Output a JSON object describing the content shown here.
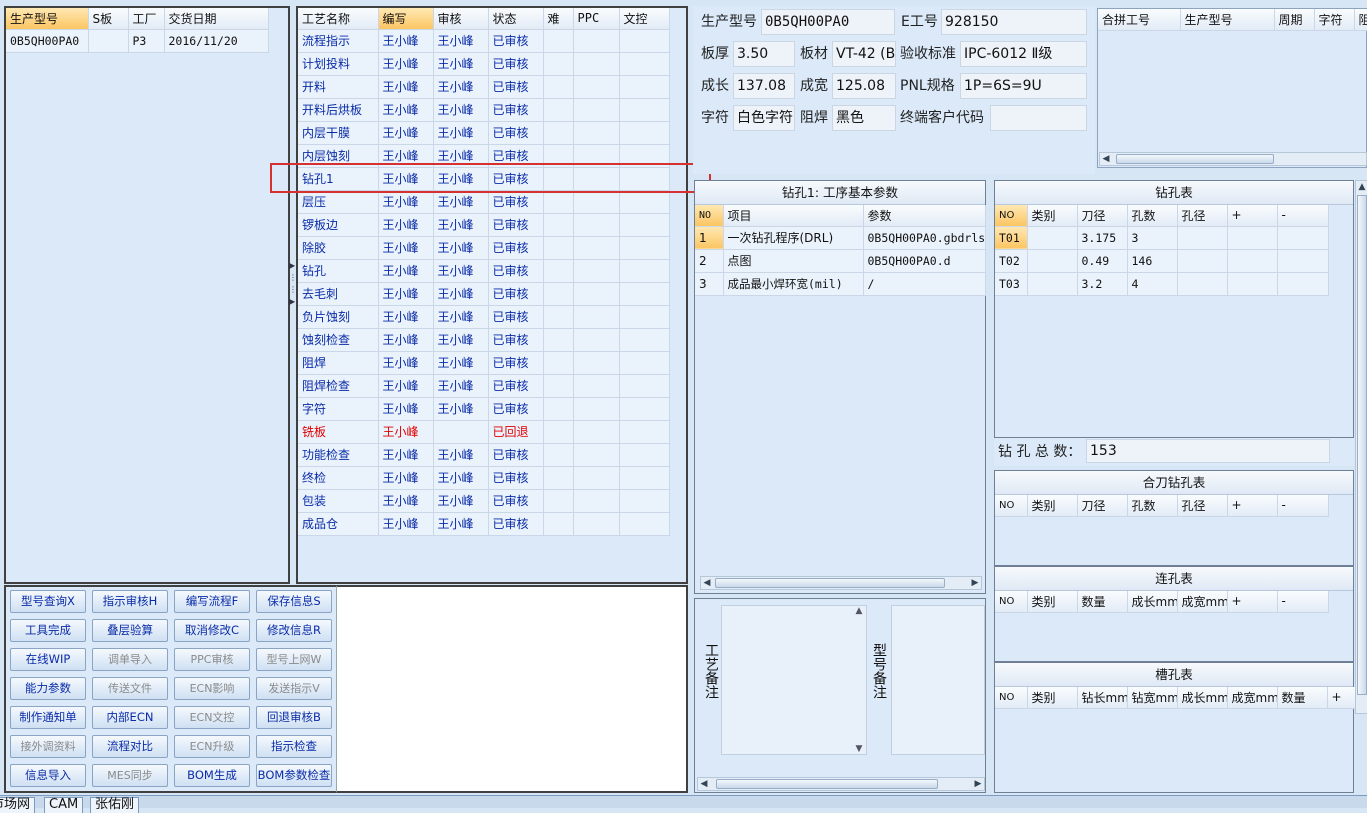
{
  "models_list": {
    "headers": [
      "生产型号",
      "S板",
      "工厂",
      "交货日期"
    ],
    "rows": [
      [
        "0B5QH00PA0",
        "",
        "P3",
        "2016/11/20"
      ]
    ]
  },
  "process_list": {
    "headers": [
      "工艺名称",
      "编写",
      "审核",
      "状态",
      "难",
      "PPC",
      "文控"
    ],
    "rows": [
      [
        "流程指示",
        "王小峰",
        "王小峰",
        "已审核"
      ],
      [
        "计划投料",
        "王小峰",
        "王小峰",
        "已审核"
      ],
      [
        "开料",
        "王小峰",
        "王小峰",
        "已审核"
      ],
      [
        "开料后烘板",
        "王小峰",
        "王小峰",
        "已审核"
      ],
      [
        "内层干膜",
        "王小峰",
        "王小峰",
        "已审核"
      ],
      [
        "内层蚀刻",
        "王小峰",
        "王小峰",
        "已审核"
      ],
      [
        "钻孔1",
        "王小峰",
        "王小峰",
        "已审核"
      ],
      [
        "层压",
        "王小峰",
        "王小峰",
        "已审核"
      ],
      [
        "锣板边",
        "王小峰",
        "王小峰",
        "已审核"
      ],
      [
        "除胶",
        "王小峰",
        "王小峰",
        "已审核"
      ],
      [
        "钻孔",
        "王小峰",
        "王小峰",
        "已审核"
      ],
      [
        "去毛刺",
        "王小峰",
        "王小峰",
        "已审核"
      ],
      [
        "负片蚀刻",
        "王小峰",
        "王小峰",
        "已审核"
      ],
      [
        "蚀刻检查",
        "王小峰",
        "王小峰",
        "已审核"
      ],
      [
        "阻焊",
        "王小峰",
        "王小峰",
        "已审核"
      ],
      [
        "阻焊检查",
        "王小峰",
        "王小峰",
        "已审核"
      ],
      [
        "字符",
        "王小峰",
        "王小峰",
        "已审核"
      ],
      [
        "铣板",
        "王小峰",
        "",
        "已回退"
      ],
      [
        "功能检查",
        "王小峰",
        "王小峰",
        "已审核"
      ],
      [
        "终检",
        "王小峰",
        "王小峰",
        "已审核"
      ],
      [
        "包装",
        "王小峰",
        "王小峰",
        "已审核"
      ],
      [
        "成品仓",
        "王小峰",
        "王小峰",
        "已审核"
      ]
    ],
    "selected_index": 6,
    "returned_index": 17
  },
  "buttons": [
    [
      "型号查询X",
      "指示审核H",
      "编写流程F",
      "保存信息S"
    ],
    [
      "工具完成",
      "叠层验算",
      "取消修改C",
      "修改信息R"
    ],
    [
      "在线WIP",
      "调单导入",
      "PPC审核",
      "型号上网W"
    ],
    [
      "能力参数",
      "传送文件",
      "ECN影响",
      "发送指示V"
    ],
    [
      "制作通知单",
      "内部ECN",
      "ECN文控",
      "回退审核B"
    ],
    [
      "接外调资料",
      "流程对比",
      "ECN升级",
      "指示检查"
    ],
    [
      "信息导入",
      "MES同步",
      "BOM生成",
      "BOM参数检查"
    ]
  ],
  "buttons_disabled": [
    [
      false,
      false,
      false,
      false
    ],
    [
      false,
      false,
      false,
      false
    ],
    [
      false,
      true,
      true,
      true
    ],
    [
      false,
      true,
      true,
      true
    ],
    [
      false,
      false,
      true,
      false
    ],
    [
      true,
      false,
      true,
      false
    ],
    [
      false,
      true,
      false,
      false
    ]
  ],
  "info": {
    "model_label": "生产型号",
    "model_value": "0B5QH00PA0",
    "eng_label": "E工号",
    "eng_value": "928150",
    "thickness_label": "板厚",
    "thickness_value": "3.50",
    "material_label": "板材",
    "material_value": "VT-42 (B",
    "standard_label": "验收标准",
    "standard_value": "IPC-6012 Ⅱ级",
    "length_label": "成长",
    "length_value": "137.08",
    "width_label": "成宽",
    "width_value": "125.08",
    "pnl_label": "PNL规格",
    "pnl_value": "1P=6S=9U",
    "char_label": "字符",
    "char_value": "白色字符",
    "mask_label": "阻焊",
    "mask_value": "黑色",
    "customer_label": "终端客户代码",
    "customer_value": ""
  },
  "merge_table": {
    "headers": [
      "合拼工号",
      "生产型号",
      "周期",
      "字符",
      "阻焊"
    ]
  },
  "params": {
    "title": "钻孔1: 工序基本参数",
    "headers": [
      "NO",
      "项目",
      "参数"
    ],
    "rows": [
      [
        "1",
        "一次钻孔程序(DRL)",
        "0B5QH00PA0.gbdrls"
      ],
      [
        "2",
        "点图",
        "0B5QH00PA0.d"
      ],
      [
        "3",
        "成品最小焊环宽(mil)",
        "/"
      ]
    ]
  },
  "remarks": {
    "process_label": "工艺备注",
    "model_label": "型号备注"
  },
  "drill_table": {
    "title": "钻孔表",
    "headers": [
      "NO",
      "类别",
      "刀径",
      "孔数",
      "孔径",
      "+",
      "-"
    ],
    "rows": [
      [
        "T01",
        "",
        "3.175",
        "3",
        "",
        "",
        ""
      ],
      [
        "T02",
        "",
        "0.49",
        "146",
        "",
        "",
        ""
      ],
      [
        "T03",
        "",
        "3.2",
        "4",
        "",
        "",
        ""
      ]
    ],
    "total_label": "钻 孔 总 数：",
    "total_value": "153"
  },
  "combined_drill": {
    "title": "合刀钻孔表",
    "headers": [
      "NO",
      "类别",
      "刀径",
      "孔数",
      "孔径",
      "+",
      "-"
    ]
  },
  "linked_holes": {
    "title": "连孔表",
    "headers": [
      "NO",
      "类别",
      "数量",
      "成长mm",
      "成宽mm",
      "+",
      "-"
    ]
  },
  "slot_holes": {
    "title": "槽孔表",
    "headers": [
      "NO",
      "类别",
      "钻长mm",
      "钻宽mm",
      "成长mm",
      "成宽mm",
      "数量",
      "+"
    ]
  },
  "tabs": [
    "市场网",
    "CAM",
    "张佑刚"
  ],
  "colors": {
    "panel_bg": "#dbe9f8",
    "selected_row": "#fbc562",
    "returned_text": "#e00000",
    "highlight_box": "#d63030"
  }
}
